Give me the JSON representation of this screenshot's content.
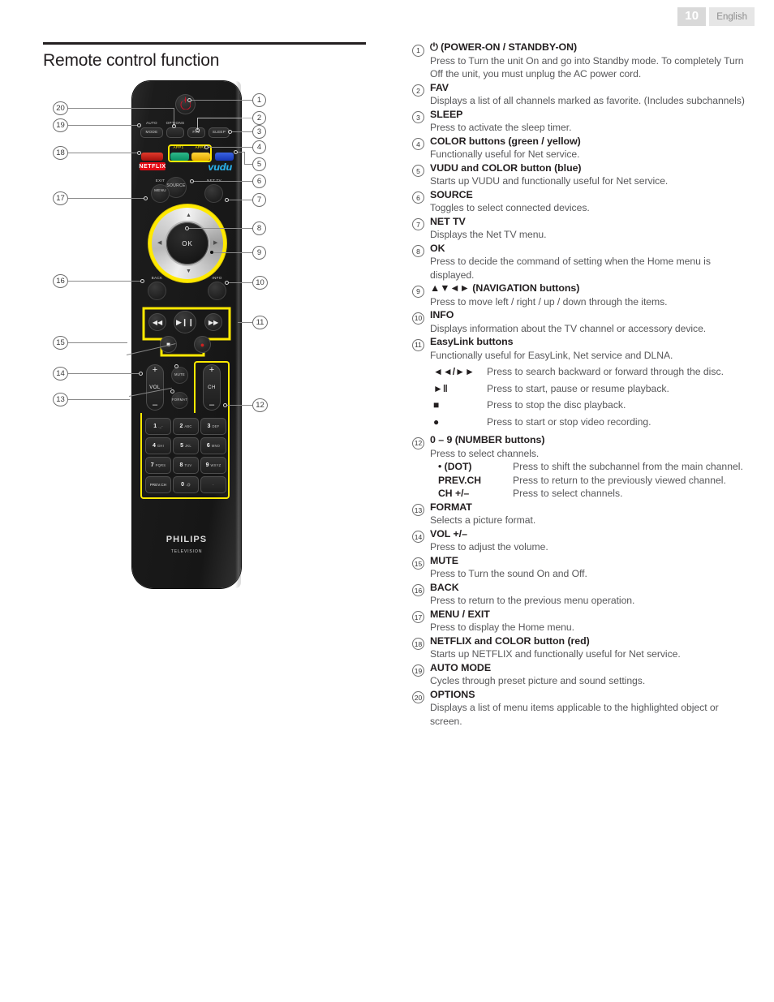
{
  "header": {
    "page_number": "10",
    "language": "English"
  },
  "section": {
    "title": "Remote control function"
  },
  "remote": {
    "brand": "PHILIPS",
    "brand_sub": "TELEVISION",
    "labels": {
      "auto": "AUTO",
      "mode": "MODE",
      "options": "OPTIONS",
      "fav": "FAV",
      "sleep": "SLEEP",
      "app1": "APP1",
      "app2": "APP2",
      "netflix": "NETFLIX",
      "vudu": "vudu",
      "source": "SOURCE",
      "net_tv": "NET TV",
      "exit": "EXIT",
      "menu": "MENU",
      "ok": "OK",
      "back": "BACK",
      "info": "INFO",
      "mute": "MUTE",
      "format": "FORMAT",
      "vol": "VOL",
      "ch": "CH",
      "plus": "+",
      "minus": "–"
    },
    "keypad": [
      {
        "big": "1",
        "sub": "._-"
      },
      {
        "big": "2",
        "sub": "ABC"
      },
      {
        "big": "3",
        "sub": "DEF"
      },
      {
        "big": "4",
        "sub": "GHI"
      },
      {
        "big": "5",
        "sub": "JKL"
      },
      {
        "big": "6",
        "sub": "MNO"
      },
      {
        "big": "7",
        "sub": "PQRS"
      },
      {
        "big": "8",
        "sub": "TUV"
      },
      {
        "big": "9",
        "sub": "WXYZ"
      },
      {
        "big": "",
        "sub": "",
        "only": "PREV.CH"
      },
      {
        "big": "0",
        "sub": ".@"
      },
      {
        "big": "",
        "sub": "",
        "only": "·"
      }
    ],
    "callouts": [
      "1",
      "2",
      "3",
      "4",
      "5",
      "6",
      "7",
      "8",
      "9",
      "10",
      "11",
      "12",
      "13",
      "14",
      "15",
      "16",
      "17",
      "18",
      "19",
      "20"
    ]
  },
  "legend": [
    {
      "num": "1",
      "title": "⏻ (POWER-ON / STANDBY-ON)",
      "desc": "Press to Turn the unit On and go into Standby mode.\nTo completely Turn Off the unit, you must unplug the AC power cord."
    },
    {
      "num": "2",
      "title": "FAV",
      "desc": "Displays a list of all channels marked as favorite.\n(Includes subchannels)"
    },
    {
      "num": "3",
      "title": "SLEEP",
      "desc": "Press to activate the sleep timer."
    },
    {
      "num": "4",
      "title": "COLOR buttons (green / yellow)",
      "desc": "Functionally useful for Net service."
    },
    {
      "num": "5",
      "title": "VUDU and COLOR button (blue)",
      "desc": "Starts up VUDU and functionally useful for Net service."
    },
    {
      "num": "6",
      "title": "SOURCE",
      "desc": "Toggles to select connected devices."
    },
    {
      "num": "7",
      "title": "NET TV",
      "desc": "Displays the Net TV menu."
    },
    {
      "num": "8",
      "title": "OK",
      "desc": "Press to decide the command of setting when the Home menu is displayed."
    },
    {
      "num": "9",
      "title": "▲▼◄► (NAVIGATION buttons)",
      "desc": "Press to move left / right / up / down through the items."
    },
    {
      "num": "10",
      "title": "INFO",
      "desc": "Displays information about the TV channel or accessory device."
    },
    {
      "num": "11",
      "title": "EasyLink buttons",
      "desc": "Functionally useful for EasyLink, Net service and DLNA.",
      "rows": [
        {
          "key": "◄◄/►►",
          "value": "Press to search backward or forward through the disc."
        },
        {
          "key": "►‖",
          "value": "Press to start, pause or resume playback."
        },
        {
          "key": "■",
          "value": "Press to stop the disc playback."
        },
        {
          "key": "●",
          "value": "Press to start or stop video recording."
        }
      ]
    },
    {
      "num": "12",
      "title": "0 – 9 (NUMBER buttons)",
      "desc": "Press to select channels.",
      "rows": [
        {
          "key": "• (DOT)",
          "value": "Press to shift the subchannel from the main channel."
        },
        {
          "key": "PREV.CH",
          "value": "Press to return to the previously viewed channel."
        },
        {
          "key": "CH +/–",
          "value": "Press to select channels."
        }
      ]
    },
    {
      "num": "13",
      "title": "FORMAT",
      "desc": "Selects a picture format."
    },
    {
      "num": "14",
      "title": "VOL +/–",
      "desc": "Press to adjust the volume."
    },
    {
      "num": "15",
      "title": "MUTE",
      "desc": "Press to Turn the sound On and Off."
    },
    {
      "num": "16",
      "title": "BACK",
      "desc": "Press to return to the previous menu operation."
    },
    {
      "num": "17",
      "title": "MENU / EXIT",
      "desc": "Press to display the Home menu."
    },
    {
      "num": "18",
      "title": "NETFLIX and COLOR button (red)",
      "desc": "Starts up NETFLIX and functionally useful for Net service."
    },
    {
      "num": "19",
      "title": "AUTO MODE",
      "desc": "Cycles through preset picture and sound settings."
    },
    {
      "num": "20",
      "title": "OPTIONS",
      "desc": "Displays a list of menu items applicable to the highlighted object or screen."
    }
  ],
  "colors": {
    "red": "#e50914",
    "green": "#0d9b6c",
    "yellow": "#ffd000",
    "blue": "#2246c8",
    "highlight": "#ffe900",
    "vudu_blue": "#29abe2",
    "body_text": "#58585a",
    "heading": "#231f20"
  }
}
